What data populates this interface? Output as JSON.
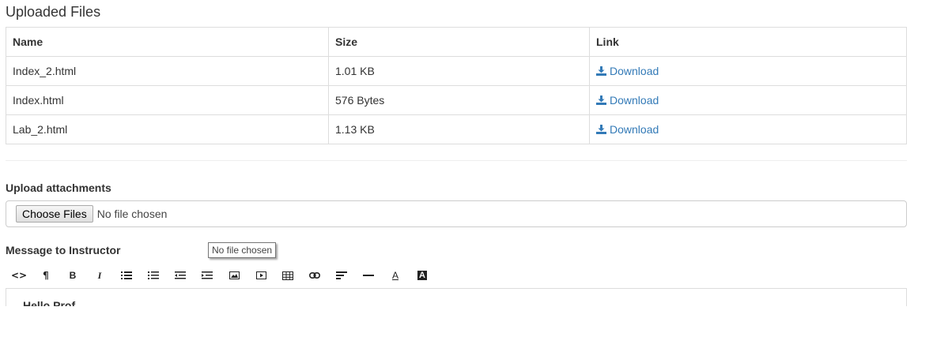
{
  "uploaded_files": {
    "title": "Uploaded Files",
    "columns": [
      "Name",
      "Size",
      "Link"
    ],
    "rows": [
      {
        "name": "Index_2.html",
        "size": "1.01 KB",
        "link": "Download"
      },
      {
        "name": "Index.html",
        "size": "576 Bytes",
        "link": "Download"
      },
      {
        "name": "Lab_2.html",
        "size": "1.13 KB",
        "link": "Download"
      }
    ]
  },
  "upload": {
    "label": "Upload attachments",
    "button_label": "Choose Files",
    "status": "No file chosen",
    "tooltip": "No file chosen"
  },
  "message": {
    "label": "Message to Instructor",
    "toolbar": [
      {
        "name": "code-view-icon",
        "glyph": "<>"
      },
      {
        "name": "paragraph-icon",
        "glyph": "¶"
      },
      {
        "name": "bold-icon",
        "glyph": "B"
      },
      {
        "name": "italic-icon",
        "glyph": "I"
      },
      {
        "name": "unordered-list-icon",
        "glyph": ""
      },
      {
        "name": "ordered-list-icon",
        "glyph": ""
      },
      {
        "name": "outdent-icon",
        "glyph": ""
      },
      {
        "name": "indent-icon",
        "glyph": ""
      },
      {
        "name": "image-icon",
        "glyph": ""
      },
      {
        "name": "video-icon",
        "glyph": ""
      },
      {
        "name": "table-icon",
        "glyph": ""
      },
      {
        "name": "link-icon",
        "glyph": ""
      },
      {
        "name": "align-icon",
        "glyph": ""
      },
      {
        "name": "horizontal-rule-icon",
        "glyph": ""
      },
      {
        "name": "font-color-icon",
        "glyph": "A"
      },
      {
        "name": "background-color-icon",
        "glyph": "A"
      }
    ],
    "body_text": "Hello Prof"
  },
  "colors": {
    "link": "#337ab7",
    "border": "#dddddd",
    "text": "#333333"
  }
}
